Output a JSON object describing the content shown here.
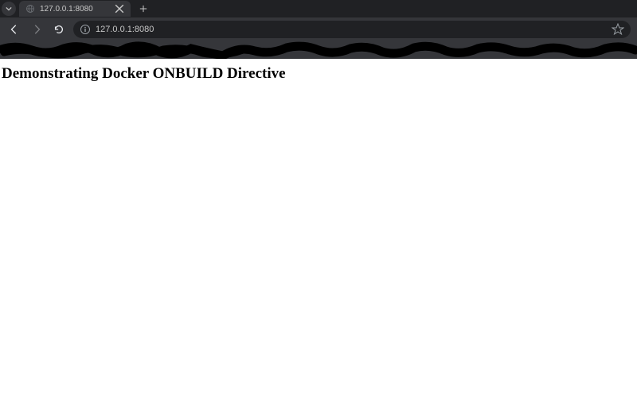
{
  "browser": {
    "tab": {
      "title": "127.0.0.1:8080"
    },
    "address": {
      "url": "127.0.0.1:8080"
    }
  },
  "page": {
    "heading": "Demonstrating Docker ONBUILD Directive"
  }
}
